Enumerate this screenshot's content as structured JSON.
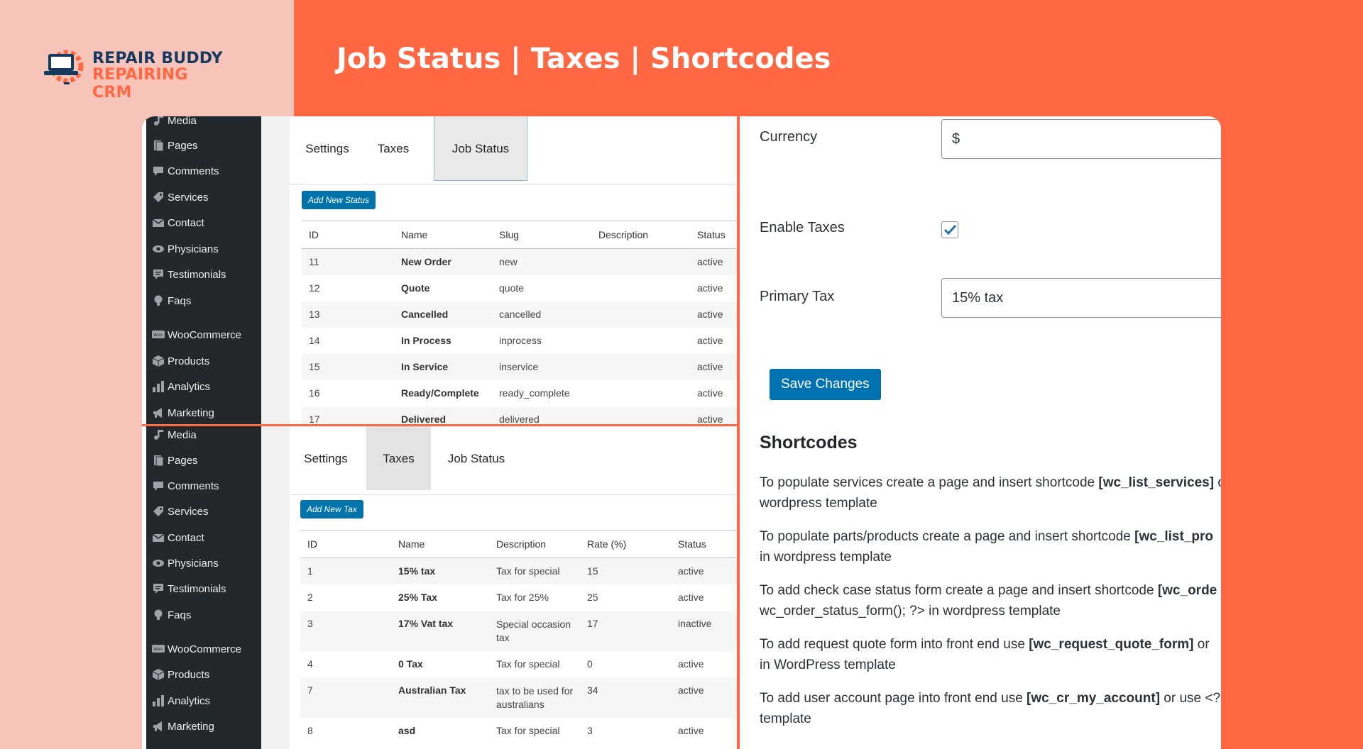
{
  "brand": {
    "line1": "REPAIR BUDDY",
    "line2": "REPAIRING CRM"
  },
  "headline": "Job Status | Taxes | Shortcodes",
  "colors": {
    "accent": "#ff6843",
    "light_bg": "#f6c4b8",
    "wp_sidebar": "#23282d",
    "wp_blue": "#0073aa",
    "brand_navy": "#163a5f"
  },
  "sidebar": {
    "items": [
      {
        "label": "Media",
        "icon": "media-icon"
      },
      {
        "label": "Pages",
        "icon": "pages-icon"
      },
      {
        "label": "Comments",
        "icon": "comments-icon"
      },
      {
        "label": "Services",
        "icon": "services-icon"
      },
      {
        "label": "Contact",
        "icon": "contact-icon"
      },
      {
        "label": "Physicians",
        "icon": "physicians-icon"
      },
      {
        "label": "Testimonials",
        "icon": "testimonials-icon"
      },
      {
        "label": "Faqs",
        "icon": "faqs-icon"
      },
      {
        "label": "WooCommerce",
        "icon": "woocommerce-icon"
      },
      {
        "label": "Products",
        "icon": "products-icon"
      },
      {
        "label": "Analytics",
        "icon": "analytics-icon"
      },
      {
        "label": "Marketing",
        "icon": "marketing-icon"
      }
    ]
  },
  "tabs": {
    "settings": "Settings",
    "taxes": "Taxes",
    "job_status": "Job Status"
  },
  "job_status": {
    "add_button": "Add New Status",
    "headers": [
      "ID",
      "Name",
      "Slug",
      "Description",
      "Status"
    ],
    "rows": [
      {
        "id": "11",
        "name": "New Order",
        "slug": "new",
        "description": "",
        "status": "active"
      },
      {
        "id": "12",
        "name": "Quote",
        "slug": "quote",
        "description": "",
        "status": "active"
      },
      {
        "id": "13",
        "name": "Cancelled",
        "slug": "cancelled",
        "description": "",
        "status": "active"
      },
      {
        "id": "14",
        "name": "In Process",
        "slug": "inprocess",
        "description": "",
        "status": "active"
      },
      {
        "id": "15",
        "name": "In Service",
        "slug": "inservice",
        "description": "",
        "status": "active"
      },
      {
        "id": "16",
        "name": "Ready/Complete",
        "slug": "ready_complete",
        "description": "",
        "status": "active"
      },
      {
        "id": "17",
        "name": "Delivered",
        "slug": "delivered",
        "description": "",
        "status": "active"
      }
    ]
  },
  "taxes": {
    "add_button": "Add New Tax",
    "headers": [
      "ID",
      "Name",
      "Description",
      "Rate (%)",
      "Status"
    ],
    "rows": [
      {
        "id": "1",
        "name": "15% tax",
        "description": "Tax for special",
        "rate": "15",
        "status": "active"
      },
      {
        "id": "2",
        "name": "25% Tax",
        "description": "Tax for 25%",
        "rate": "25",
        "status": "active"
      },
      {
        "id": "3",
        "name": "17% Vat tax",
        "description": "Special occasion tax",
        "rate": "17",
        "status": "inactive"
      },
      {
        "id": "4",
        "name": "0 Tax",
        "description": "Tax for special",
        "rate": "0",
        "status": "active"
      },
      {
        "id": "7",
        "name": "Australian Tax",
        "description": "tax to be used for australians",
        "rate": "34",
        "status": "active"
      },
      {
        "id": "8",
        "name": "asd",
        "description": "Tax for special",
        "rate": "3",
        "status": "active"
      }
    ]
  },
  "settings": {
    "currency_label": "Currency",
    "currency_value": "$",
    "enable_taxes_label": "Enable Taxes",
    "enable_taxes_checked": true,
    "primary_tax_label": "Primary Tax",
    "primary_tax_value": "15% tax",
    "save_button": "Save Changes"
  },
  "shortcodes": {
    "title": "Shortcodes",
    "p1_pre": "To populate services create a page and insert shortcode ",
    "p1_code": "[wc_list_services]",
    "p1_post": " o",
    "p1_line2": "wordpress template",
    "p2_pre": "To populate parts/products create a page and insert shortcode ",
    "p2_code": "[wc_list_pro",
    "p2_line2": "in wordpress template",
    "p3_pre": "To add check case status form create a page and insert shortcode ",
    "p3_code": "[wc_orde",
    "p3_line2": "wc_order_status_form(); ?> in wordpress template",
    "p4_pre": "To add request quote form into front end use ",
    "p4_code": "[wc_request_quote_form]",
    "p4_post": " or",
    "p4_line2": "in WordPress template",
    "p5_pre": "To add user account page into front end use ",
    "p5_code": "[wc_cr_my_account]",
    "p5_post": " or use <?",
    "p5_line2": "template"
  }
}
